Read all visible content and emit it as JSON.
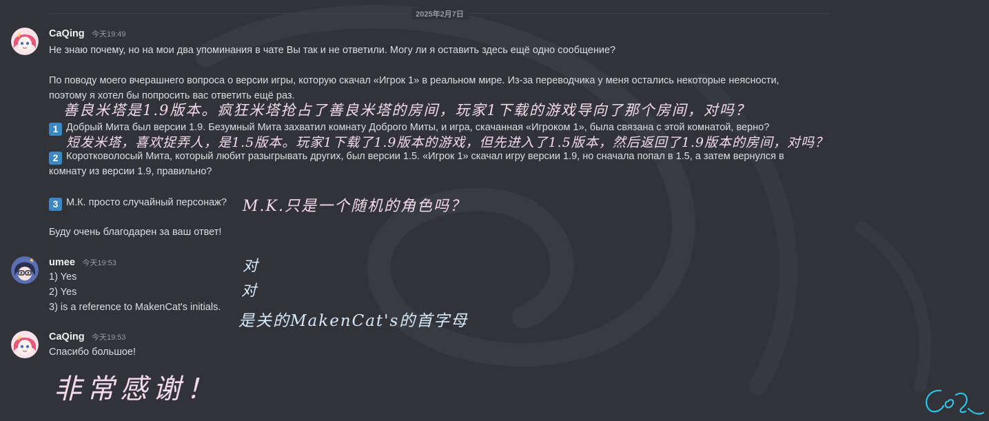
{
  "divider": {
    "date": "2025年2月7日"
  },
  "messages": {
    "m1": {
      "username": "CaQing",
      "timestamp": "今天19:49",
      "lines": [
        "Не знаю почему, но на мои два упоминания в чате Вы так и не ответили. Могу ли я оставить здесь ещё одно сообщение?",
        "По поводу моего вчерашнего вопроса о версии игры, которую скачал «Игрок 1» в реальном мире. Из-за переводчика у меня остались некоторые неясности,",
        "поэтому я хотел бы попросить вас ответить ещё раз.",
        "Добрый Мита был версии 1.9. Безумный Мита захватил комнату Доброго Миты, и игра, скачанная «Игроком 1», была связана с этой комнатой, верно?",
        "Коротковолосый Мита, который любит разыгрывать других, был версии 1.5. «Игрок 1» скачал игру версии 1.9, но сначала попал в 1.5, а затем вернулся в",
        "комнату из версии 1.9, правильно?",
        "М.К. просто случайный персонаж?",
        "Буду очень благодарен за ваш ответ!"
      ],
      "badges": [
        "1",
        "2",
        "3"
      ],
      "annotations": [
        "善良米塔是1.9版本。疯狂米塔抢占了善良米塔的房间，玩家1下载的游戏导向了那个房间，对吗？",
        "短发米塔，喜欢捉弄人，是1.5版本。玩家1下载了1.9版本的游戏，但先进入了1.5版本，然后返回了1.9版本的房间，对吗？",
        "M.K.只是一个随机的角色吗？"
      ]
    },
    "m2": {
      "username": "umee",
      "timestamp": "今天19:53",
      "lines": [
        "1) Yes",
        "2) Yes",
        "3) is a reference to MakenCat's initials."
      ],
      "annotations": [
        "对",
        "对",
        "是关的MakenCat's的首字母"
      ]
    },
    "m3": {
      "username": "CaQing",
      "timestamp": "今天19:53",
      "lines": [
        "Спасибо большое!"
      ],
      "annotations": [
        "非常感谢！"
      ]
    }
  },
  "signature": {
    "text": "CaQing"
  },
  "colors": {
    "background": "#313338",
    "text": "#dbdee1",
    "username": "#f2f3f5",
    "muted": "#949ba4",
    "badge": "#3b88c3",
    "handwriting_pink": "#f2d9ee",
    "handwriting_blue": "#d7eafc",
    "signature": "#29c4e8"
  }
}
